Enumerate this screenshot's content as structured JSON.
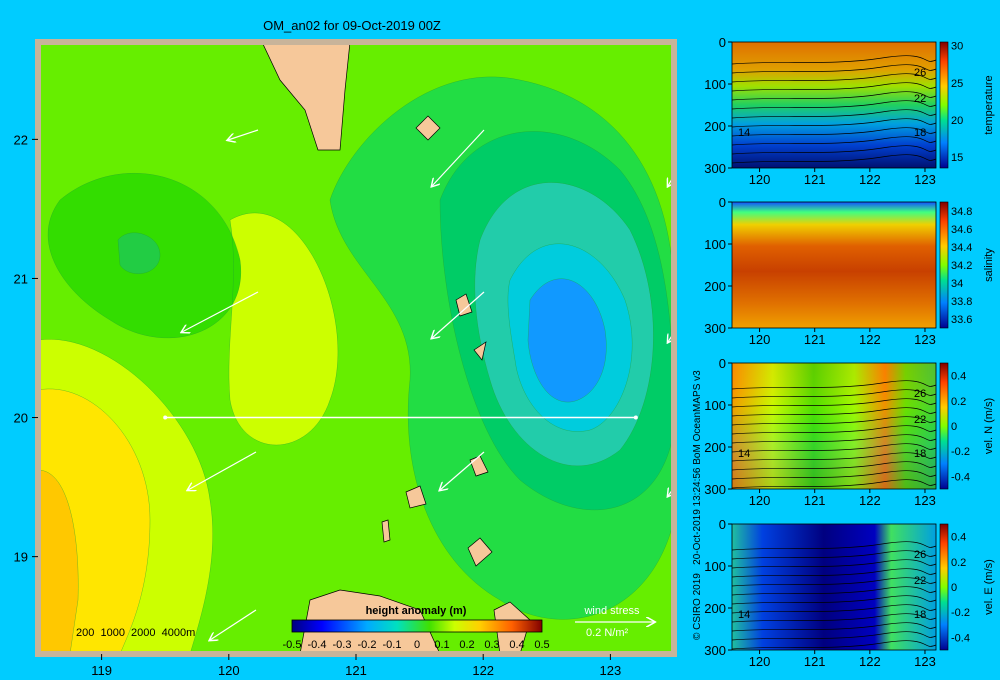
{
  "title": "OM_an02 for 09-Oct-2019 00Z",
  "credit": "© CSIRO 2019   20-Oct-2019 13:24:56 BoM OceanMAPS v3",
  "map": {
    "x_ticks": [
      "119",
      "120",
      "121",
      "122",
      "123"
    ],
    "y_ticks": [
      "19",
      "20",
      "21",
      "22"
    ],
    "depth_legend": "200  1000  2000  4000m",
    "colorbar": {
      "title": "height anomaly (m)",
      "ticks": [
        "-0.5",
        "-0.4",
        "-0.3",
        "-0.2",
        "-0.1",
        "0",
        "0.1",
        "0.2",
        "0.3",
        "0.4",
        "0.5"
      ]
    },
    "wind_stress": {
      "label": "wind stress",
      "unit": "0.2 N/m²"
    }
  },
  "chart_data": [
    {
      "type": "heatmap",
      "title": "OM_an02 for 09-Oct-2019 00Z",
      "variable": "height anomaly (m)",
      "x_range": [
        118.5,
        123.5
      ],
      "y_range": [
        18.3,
        22.7
      ],
      "clim": [
        -0.5,
        0.5
      ],
      "section_line": {
        "lon": [
          119.5,
          123.2
        ],
        "lat": [
          20.0,
          20.0
        ]
      },
      "features": [
        {
          "label": "low",
          "lon": 122.7,
          "lat": 20.7,
          "value": -0.3
        },
        {
          "label": "high",
          "lon": 118.6,
          "lat": 19.0,
          "value": 0.25
        },
        {
          "label": "local low",
          "lon": 119.3,
          "lat": 21.2,
          "value": -0.05
        }
      ]
    },
    {
      "type": "heatmap",
      "variable": "temperature",
      "x_ticks": [
        "120",
        "121",
        "122",
        "123"
      ],
      "y_ticks": [
        "0",
        "100",
        "200",
        "300"
      ],
      "colorbar_ticks": [
        "30",
        "25",
        "20",
        "15"
      ],
      "clim": [
        13.5,
        30.5
      ],
      "contour_labels": [
        "26",
        "22",
        "18",
        "14"
      ]
    },
    {
      "type": "heatmap",
      "variable": "salinity",
      "x_ticks": [
        "120",
        "121",
        "122",
        "123"
      ],
      "y_ticks": [
        "0",
        "100",
        "200",
        "300"
      ],
      "colorbar_ticks": [
        "34.8",
        "34.6",
        "34.4",
        "34.2",
        "34",
        "33.8",
        "33.6"
      ],
      "clim": [
        33.5,
        34.9
      ]
    },
    {
      "type": "heatmap",
      "variable": "vel. N (m/s)",
      "x_ticks": [
        "120",
        "121",
        "122",
        "123"
      ],
      "y_ticks": [
        "0",
        "100",
        "200",
        "300"
      ],
      "colorbar_ticks": [
        "0.4",
        "0.2",
        "0",
        "-0.2",
        "-0.4"
      ],
      "clim": [
        -0.5,
        0.5
      ],
      "contour_labels": [
        "26",
        "22",
        "18",
        "14"
      ]
    },
    {
      "type": "heatmap",
      "variable": "vel. E (m/s)",
      "x_ticks": [
        "120",
        "121",
        "122",
        "123"
      ],
      "y_ticks": [
        "0",
        "100",
        "200",
        "300"
      ],
      "colorbar_ticks": [
        "0.4",
        "0.2",
        "0",
        "-0.2",
        "-0.4"
      ],
      "clim": [
        -0.5,
        0.5
      ],
      "contour_labels": [
        "26",
        "22",
        "18",
        "14"
      ]
    }
  ]
}
